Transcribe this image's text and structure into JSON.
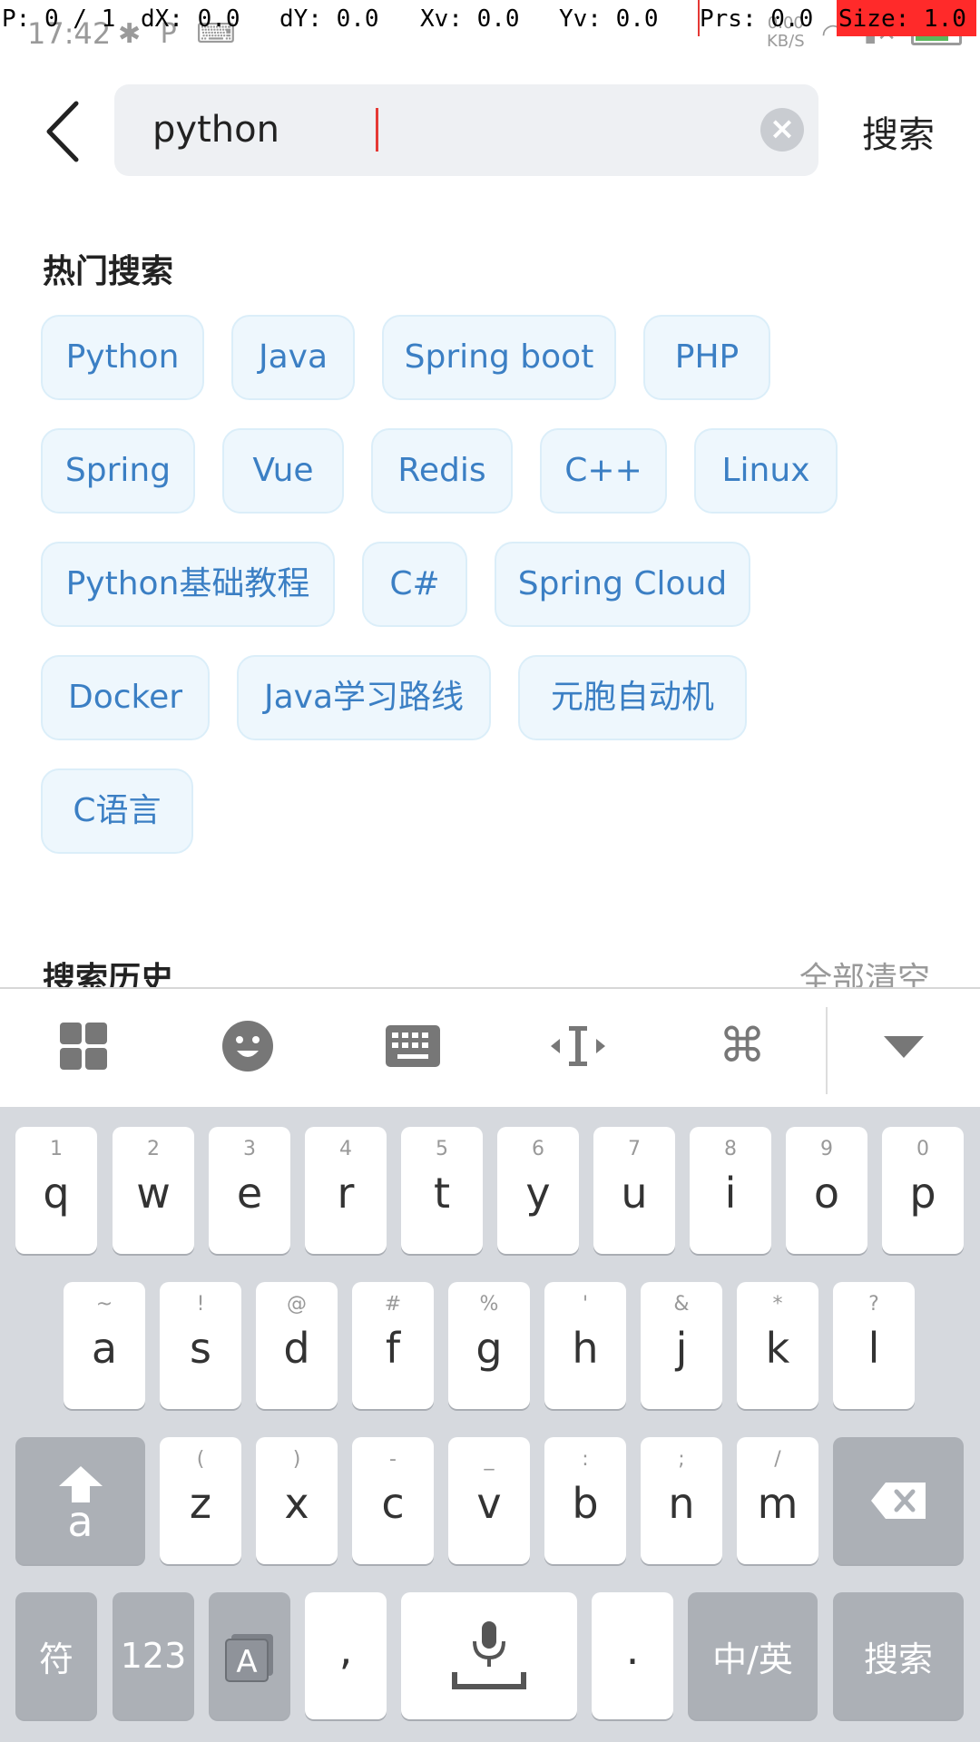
{
  "status_bar": {
    "time": "17:42",
    "net_speed_value": "0.00",
    "net_speed_unit": "KB/S"
  },
  "debug_overlay": {
    "p": "P: 0 / 1",
    "dx": "dX: 0.0",
    "dy": "dY: 0.0",
    "xv": "Xv: 0.0",
    "yv": "Yv: 0.0",
    "prs": "Prs: 0.0",
    "size": "Size: 1.0"
  },
  "search": {
    "value": "python",
    "action_label": "搜索"
  },
  "hot_search": {
    "title": "热门搜索",
    "tags": [
      "Python",
      "Java",
      "Spring boot",
      "PHP",
      "Spring",
      "Vue",
      "Redis",
      "C++",
      "Linux",
      "Python基础教程",
      "C#",
      "Spring Cloud",
      "Docker",
      "Java学习路线",
      "元胞自动机",
      "C语言"
    ]
  },
  "history": {
    "title": "搜索历史",
    "clear_label": "全部清空"
  },
  "keyboard": {
    "row1": [
      {
        "sub": "1",
        "key": "q"
      },
      {
        "sub": "2",
        "key": "w"
      },
      {
        "sub": "3",
        "key": "e"
      },
      {
        "sub": "4",
        "key": "r"
      },
      {
        "sub": "5",
        "key": "t"
      },
      {
        "sub": "6",
        "key": "y"
      },
      {
        "sub": "7",
        "key": "u"
      },
      {
        "sub": "8",
        "key": "i"
      },
      {
        "sub": "9",
        "key": "o"
      },
      {
        "sub": "0",
        "key": "p"
      }
    ],
    "row2": [
      {
        "sub": "~",
        "key": "a"
      },
      {
        "sub": "!",
        "key": "s"
      },
      {
        "sub": "@",
        "key": "d"
      },
      {
        "sub": "#",
        "key": "f"
      },
      {
        "sub": "%",
        "key": "g"
      },
      {
        "sub": "'",
        "key": "h"
      },
      {
        "sub": "&",
        "key": "j"
      },
      {
        "sub": "*",
        "key": "k"
      },
      {
        "sub": "?",
        "key": "l"
      }
    ],
    "row3": [
      {
        "sub": "(",
        "key": "z"
      },
      {
        "sub": ")",
        "key": "x"
      },
      {
        "sub": "-",
        "key": "c"
      },
      {
        "sub": "_",
        "key": "v"
      },
      {
        "sub": ":",
        "key": "b"
      },
      {
        "sub": ";",
        "key": "n"
      },
      {
        "sub": "/",
        "key": "m"
      }
    ],
    "shift_label": "a",
    "symbols_label": "符",
    "numbers_label": "123",
    "comma_label": ",",
    "period_label": ".",
    "lang_label": "中/英",
    "enter_label": "搜索"
  }
}
